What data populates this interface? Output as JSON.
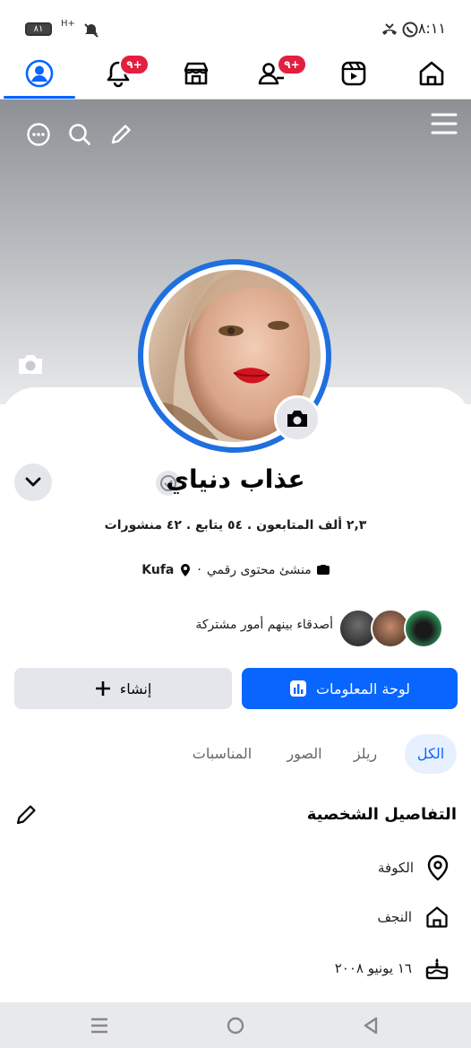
{
  "status_bar": {
    "time": "٨:١١",
    "battery": "٨١",
    "network": "H+"
  },
  "top_nav": {
    "items": [
      {
        "id": "profile",
        "icon": "profile-icon",
        "active": true
      },
      {
        "id": "notifications",
        "icon": "bell-icon",
        "badge": "٩+"
      },
      {
        "id": "marketplace",
        "icon": "store-icon"
      },
      {
        "id": "friends",
        "icon": "friends-icon",
        "badge": "٩+"
      },
      {
        "id": "reels",
        "icon": "video-icon"
      },
      {
        "id": "home",
        "icon": "home-icon"
      }
    ]
  },
  "profile": {
    "name": "عذاب دنياي",
    "stats": "٢,٣ ألف المتابعون . ٥٤ يتابع . ٤٢ منشورات",
    "meta_category": "منشئ محتوى رقمي",
    "meta_separator": "·",
    "meta_location": "Kufa",
    "mutual_friends_text": "أصدقاء بينهم أمور مشتركة"
  },
  "buttons": {
    "dashboard": "لوحة المعلومات",
    "create": "إنشاء"
  },
  "tabs": [
    {
      "label": "الكل",
      "active": true
    },
    {
      "label": "ريلز"
    },
    {
      "label": "الصور"
    },
    {
      "label": "المناسبات"
    }
  ],
  "details": {
    "title": "التفاصيل الشخصية",
    "rows": [
      {
        "icon": "location-pin-icon",
        "text": "الكوفة"
      },
      {
        "icon": "home-icon",
        "text": "النجف"
      },
      {
        "icon": "birthday-cake-icon",
        "text": "١٦ يونيو ٢٠٠٨"
      }
    ]
  },
  "colors": {
    "accent": "#0866ff",
    "badge": "#e41e3f",
    "secondary_button": "#e4e6eb"
  }
}
